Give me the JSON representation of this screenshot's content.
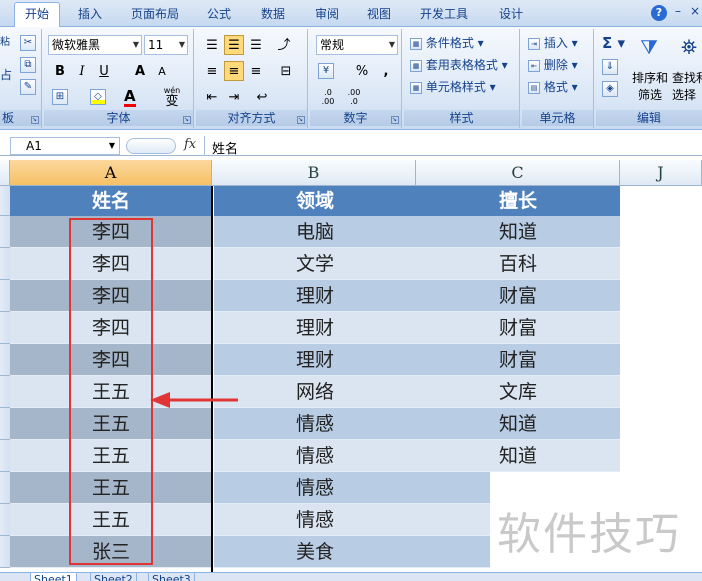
{
  "ribbon_tabs": [
    "开始",
    "插入",
    "页面布局",
    "公式",
    "数据",
    "审阅",
    "视图",
    "开发工具",
    "设计"
  ],
  "help_symbol": "?",
  "window_controls": {
    "minimize": "–",
    "close": "×"
  },
  "clipboard": {
    "group_label": "板",
    "paste_stub": "粘",
    "paste_stub2": "占"
  },
  "font_group": {
    "font_name": "微软雅黑",
    "font_size": "11",
    "group_label": "字体",
    "bold": "B",
    "italic": "I",
    "underline": "U",
    "grow": "A",
    "shrink": "A",
    "wen": "wén",
    "wen_char": "变"
  },
  "align_group": {
    "group_label": "对齐方式"
  },
  "number_group": {
    "format": "常规",
    "group_label": "数字",
    "percent": "%",
    "comma": ",",
    "inc": ".0 .00",
    "dec": ".00 .0"
  },
  "styles_group": {
    "conditional": "条件格式",
    "table": "套用表格格式",
    "cell_styles": "单元格样式",
    "group_label": "样式"
  },
  "cells_group": {
    "insert": "插入",
    "delete": "删除",
    "format": "格式",
    "group_label": "单元格"
  },
  "editing_group": {
    "sum_symbol": "Σ",
    "sort_label_1": "排序和",
    "sort_label_2": "筛选",
    "find_label_1": "查找和",
    "find_label_2": "选择",
    "group_label": "编辑"
  },
  "formula_bar": {
    "name_box": "A1",
    "fx": "fx",
    "content": "姓名"
  },
  "columns": [
    "A",
    "B",
    "C",
    "J"
  ],
  "headers": [
    "姓名",
    "领域",
    "擅长"
  ],
  "rows": [
    [
      "李四",
      "电脑",
      "知道"
    ],
    [
      "李四",
      "文学",
      "百科"
    ],
    [
      "李四",
      "理财",
      "财富"
    ],
    [
      "李四",
      "理财",
      "财富"
    ],
    [
      "李四",
      "理财",
      "财富"
    ],
    [
      "王五",
      "网络",
      "文库"
    ],
    [
      "王五",
      "情感",
      "知道"
    ],
    [
      "王五",
      "情感",
      "知道"
    ],
    [
      "王五",
      "情感",
      ""
    ],
    [
      "王五",
      "情感",
      ""
    ],
    [
      "张三",
      "美食",
      ""
    ]
  ],
  "sheet_tabs": [
    "Sheet1",
    "Sheet2",
    "Sheet3"
  ],
  "watermark": "软件技巧",
  "colors": {
    "header_blue": "#4f81bd",
    "band_dark": "#b8cce4",
    "band_light": "#dbe5f1",
    "band_colA_dark": "#a5b5ca",
    "red": "#e03535"
  }
}
